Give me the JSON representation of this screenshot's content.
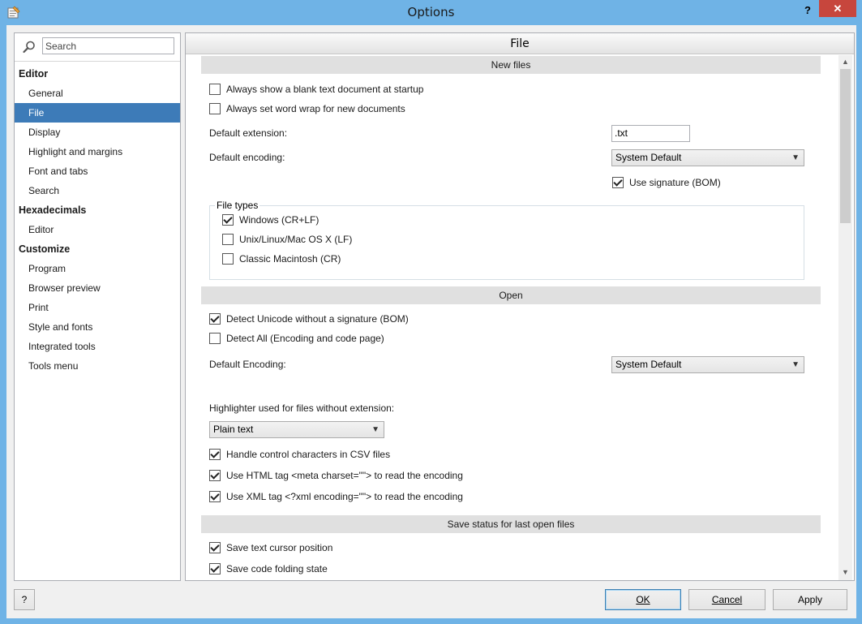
{
  "window": {
    "title": "Options",
    "help_glyph": "?",
    "close_glyph": "✕"
  },
  "sidebar": {
    "search_placeholder": "Search",
    "items": [
      {
        "label": "Editor",
        "group": true
      },
      {
        "label": "General"
      },
      {
        "label": "File",
        "active": true
      },
      {
        "label": "Display"
      },
      {
        "label": "Highlight and margins"
      },
      {
        "label": "Font and tabs"
      },
      {
        "label": "Search"
      },
      {
        "label": "Hexadecimals",
        "group": true
      },
      {
        "label": "Editor"
      },
      {
        "label": "Customize",
        "group": true
      },
      {
        "label": "Program"
      },
      {
        "label": "Browser preview"
      },
      {
        "label": "Print"
      },
      {
        "label": "Style and fonts"
      },
      {
        "label": "Integrated tools"
      },
      {
        "label": "Tools menu"
      }
    ]
  },
  "panel": {
    "title": "File",
    "new_files": {
      "header": "New files",
      "always_blank": {
        "label": "Always show a blank text document at startup",
        "checked": false
      },
      "word_wrap": {
        "label": "Always set word wrap for new documents",
        "checked": false
      },
      "default_extension_label": "Default extension:",
      "default_extension_value": ".txt",
      "default_encoding_label": "Default encoding:",
      "default_encoding_value": "System Default",
      "use_signature": {
        "label": "Use signature (BOM)",
        "checked": true
      },
      "file_types_label": "File types",
      "file_types": [
        {
          "label": "Windows (CR+LF)",
          "checked": true
        },
        {
          "label": "Unix/Linux/Mac OS X (LF)",
          "checked": false
        },
        {
          "label": "Classic Macintosh (CR)",
          "checked": false
        }
      ]
    },
    "open": {
      "header": "Open",
      "detect_unicode": {
        "label": "Detect Unicode without a signature (BOM)",
        "checked": true
      },
      "detect_all": {
        "label": "Detect All (Encoding and code page)",
        "checked": false
      },
      "default_encoding_label": "Default Encoding:",
      "default_encoding_value": "System Default",
      "highlighter_label": "Highlighter used for files without extension:",
      "highlighter_value": "Plain text",
      "csv_control": {
        "label": "Handle control characters in CSV files",
        "checked": true
      },
      "html_meta": {
        "label": "Use HTML tag <meta charset=\"\"> to read the encoding",
        "checked": true
      },
      "xml_encoding": {
        "label": "Use XML tag <?xml encoding=\"\"> to read the encoding",
        "checked": true
      }
    },
    "save_status": {
      "header": "Save status for last open files",
      "cursor_position": {
        "label": "Save text cursor position",
        "checked": true
      },
      "folding_state": {
        "label": "Save code folding state",
        "checked": true
      }
    }
  },
  "buttons": {
    "help": "?",
    "ok": "OK",
    "cancel": "Cancel",
    "apply": "Apply"
  }
}
